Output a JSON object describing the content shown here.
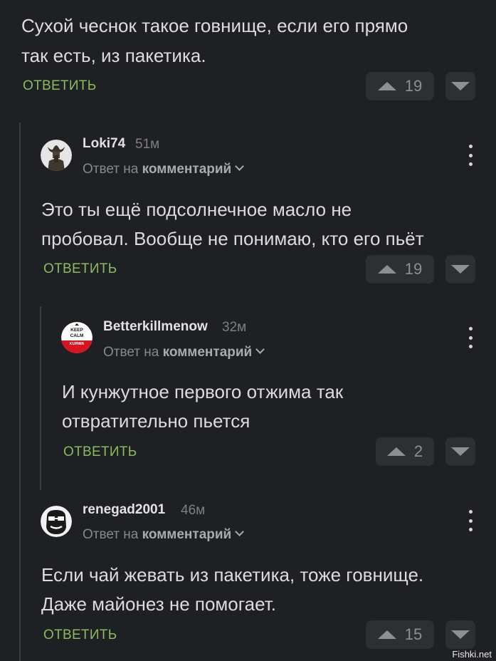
{
  "top_comment": {
    "text_line1": "Сухой чеснок такое говнище, если его прямо",
    "text_line2": "так есть, из пакетика.",
    "reply_label": "ОТВЕТИТЬ",
    "rating": "19"
  },
  "comments": [
    {
      "username": "Loki74",
      "time": "51м",
      "reply_to_prefix": "Ответ на",
      "reply_to_link": "комментарий",
      "text_line1": "Это ты ещё подсолнечное масло не",
      "text_line2": "пробовал. Вообще не понимаю, кто его пьёт",
      "reply_label": "ОТВЕТИТЬ",
      "rating": "19",
      "avatar_icon": "horned-helmet-avatar"
    },
    {
      "username": "Betterkillmenow",
      "time": "32м",
      "reply_to_prefix": "Ответ на",
      "reply_to_link": "комментарий",
      "text_line1": "И кунжутное первого отжима так",
      "text_line2": "отвратительно пьется",
      "reply_label": "ОТВЕТИТЬ",
      "rating": "2",
      "avatar_icon": "keep-calm-avatar",
      "avatar_text": {
        "line1": "KEEP",
        "line2": "CALM",
        "line3": "KURWA"
      }
    },
    {
      "username": "renegad2001",
      "time": "46м",
      "reply_to_prefix": "Ответ на",
      "reply_to_link": "комментарий",
      "text_line1": "Если чай жевать из пакетика, тоже говнище.",
      "text_line2": "Даже майонез не помогает.",
      "reply_label": "ОТВЕТИТЬ",
      "rating": "15",
      "avatar_icon": "gorilla-glasses-avatar"
    }
  ],
  "icons": {
    "upvote": "triangle-up-icon",
    "downvote": "triangle-down-icon",
    "more": "kebab-menu-icon",
    "expand": "chevron-down-icon"
  },
  "colors": {
    "background": "#1f2023",
    "reply_green": "#8bbb5c",
    "vote_bg": "#2d2f33"
  },
  "watermark": "Fishki.net"
}
